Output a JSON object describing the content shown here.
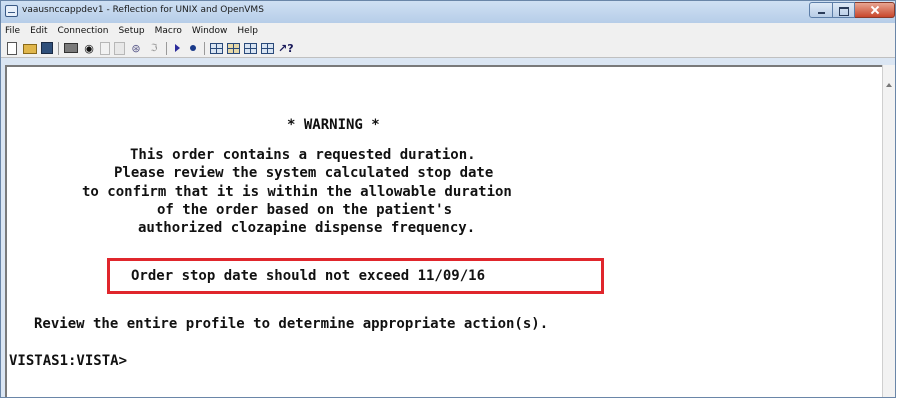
{
  "window": {
    "title": "vaausnccappdev1 - Reflection for UNIX and OpenVMS",
    "icon": "terminal-app-icon"
  },
  "menu": [
    "File",
    "Edit",
    "Connection",
    "Setup",
    "Macro",
    "Window",
    "Help"
  ],
  "toolbar": {
    "buttons": [
      "new-session-icon",
      "open-folder-icon",
      "save-icon",
      "print-icon",
      "find-binoculars-icon",
      "copy-icon",
      "paste-icon",
      "connect-icon",
      "disconnect-icon",
      "play-macro-icon",
      "record-macro-icon",
      "grid-view-icon",
      "grid-split-icon",
      "grid-panel-icon",
      "grid-layout-icon",
      "context-help-icon"
    ]
  },
  "terminal": {
    "warning_header": "* WARNING *",
    "message_lines": [
      "This order contains a requested duration.",
      "Please review the system calculated stop date",
      "to confirm that it is within the allowable duration",
      "of the order based on the patient's",
      "authorized clozapine dispense frequency."
    ],
    "highlighted_line": "Order stop date should not exceed 11/09/16",
    "review_line": "Review the entire profile to determine appropriate action(s).",
    "prompt": "VISTAS1:VISTA>"
  },
  "colors": {
    "highlight_border": "#e0262c",
    "terminal_background": "#ffffff",
    "terminal_text": "#111111"
  }
}
